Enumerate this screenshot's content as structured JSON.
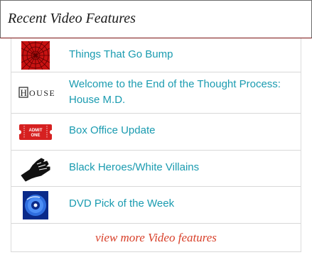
{
  "widget": {
    "title": "Recent Video Features",
    "more_link": "view more Video features"
  },
  "items": [
    {
      "title": "Things That Go Bump",
      "thumb_icon": "red-radial-pattern-thumbnail"
    },
    {
      "title": "Welcome to the End of the Thought Process: House M.D.",
      "thumb_icon": "house-logo-thumbnail",
      "thumb_text": "HOUSE"
    },
    {
      "title": "Box Office Update",
      "thumb_icon": "admit-one-ticket-thumbnail",
      "thumb_text": "ADMIT ONE"
    },
    {
      "title": "Black Heroes/White Villains",
      "thumb_icon": "raised-fist-thumbnail"
    },
    {
      "title": "DVD Pick of the Week",
      "thumb_icon": "dvd-disc-thumbnail"
    }
  ],
  "colors": {
    "link": "#1a9bb0",
    "more_link": "#d8402a",
    "header_border": "#7a1212"
  }
}
